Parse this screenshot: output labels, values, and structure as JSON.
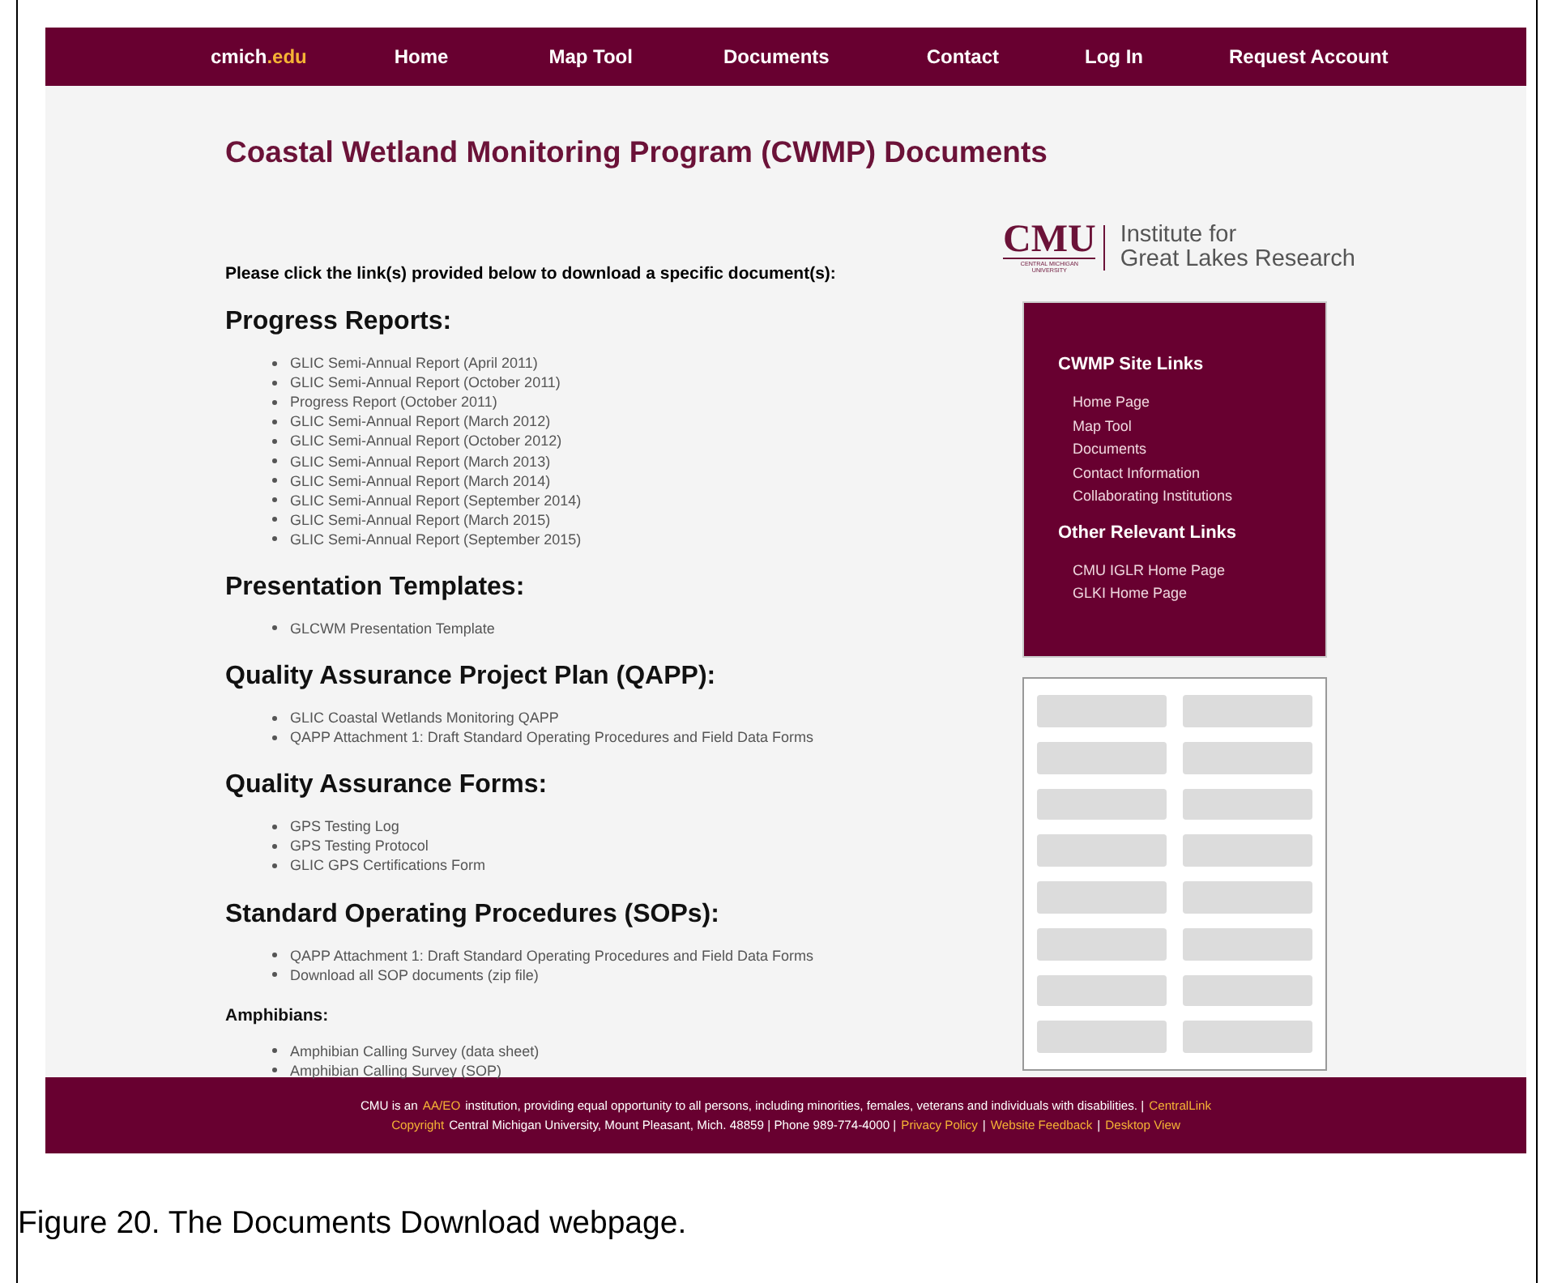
{
  "nav": {
    "brand": {
      "main": "cmich",
      "accent": ".edu"
    },
    "items": [
      "Home",
      "Map Tool",
      "Documents",
      "Contact",
      "Log In",
      "Request Account"
    ]
  },
  "page_title": "Coastal Wetland Monitoring Program (CWMP) Documents",
  "instruction": "Please click the link(s) provided below to download a specific document(s):",
  "sections": [
    {
      "kind": "major",
      "heading": "Progress Reports:",
      "links": [
        "GLIC Semi-Annual Report (April 2011)",
        "GLIC Semi-Annual Report (October 2011)",
        "Progress Report (October 2011)",
        "GLIC Semi-Annual Report (March 2012)",
        "GLIC Semi-Annual Report (October 2012)",
        "GLIC Semi-Annual Report (March 2013)",
        "GLIC Semi-Annual Report (March 2014)",
        "GLIC Semi-Annual Report (September 2014)",
        "GLIC Semi-Annual Report (March 2015)",
        "GLIC Semi-Annual Report (September 2015)"
      ]
    },
    {
      "kind": "major",
      "heading": "Presentation Templates:",
      "links": [
        "GLCWM Presentation Template"
      ]
    },
    {
      "kind": "major",
      "heading": "Quality Assurance Project Plan (QAPP):",
      "links": [
        "GLIC Coastal Wetlands Monitoring QAPP",
        "QAPP Attachment 1: Draft Standard Operating Procedures and Field Data Forms"
      ]
    },
    {
      "kind": "major",
      "heading": "Quality Assurance Forms:",
      "links": [
        "GPS Testing Log",
        "GPS Testing Protocol",
        "GLIC GPS Certifications Form"
      ]
    },
    {
      "kind": "major",
      "heading": "Standard Operating Procedures (SOPs):",
      "links": [
        "QAPP Attachment 1: Draft Standard Operating Procedures and Field Data Forms",
        "Download all SOP documents (zip file)"
      ]
    },
    {
      "kind": "minor",
      "heading": "Amphibians:",
      "links": [
        "Amphibian Calling Survey (data sheet)",
        "Amphibian Calling Survey (SOP)"
      ]
    }
  ],
  "logo": {
    "mark": "CMU",
    "subtitle": "CENTRAL MICHIGAN UNIVERSITY",
    "institute": [
      "Institute for",
      "Great Lakes Research"
    ]
  },
  "sidebar": {
    "groups": [
      {
        "heading": "CWMP Site Links",
        "links": [
          "Home Page",
          "Map Tool",
          "Documents",
          "Contact Information",
          "Collaborating Institutions"
        ]
      },
      {
        "heading": "Other Relevant Links",
        "links": [
          "CMU IGLR Home Page",
          "GLKI Home Page"
        ]
      }
    ]
  },
  "footer": {
    "lines": [
      [
        {
          "kind": "text",
          "text": "CMU is an"
        },
        {
          "kind": "link",
          "text": "AA/EO"
        },
        {
          "kind": "text",
          "text": "institution, providing equal opportunity to all persons, including minorities, females, veterans and individuals with disabilities. |"
        },
        {
          "kind": "link",
          "text": "CentralLink"
        }
      ],
      [
        {
          "kind": "link",
          "text": "Copyright"
        },
        {
          "kind": "text",
          "text": "Central Michigan University, Mount Pleasant, Mich. 48859 | Phone 989-774-4000 |"
        },
        {
          "kind": "link",
          "text": "Privacy Policy"
        },
        {
          "kind": "text",
          "text": "|"
        },
        {
          "kind": "link",
          "text": "Website Feedback"
        },
        {
          "kind": "text",
          "text": "|"
        },
        {
          "kind": "link",
          "text": "Desktop View"
        }
      ]
    ]
  },
  "caption": "Figure 20. The Documents Download webpage."
}
